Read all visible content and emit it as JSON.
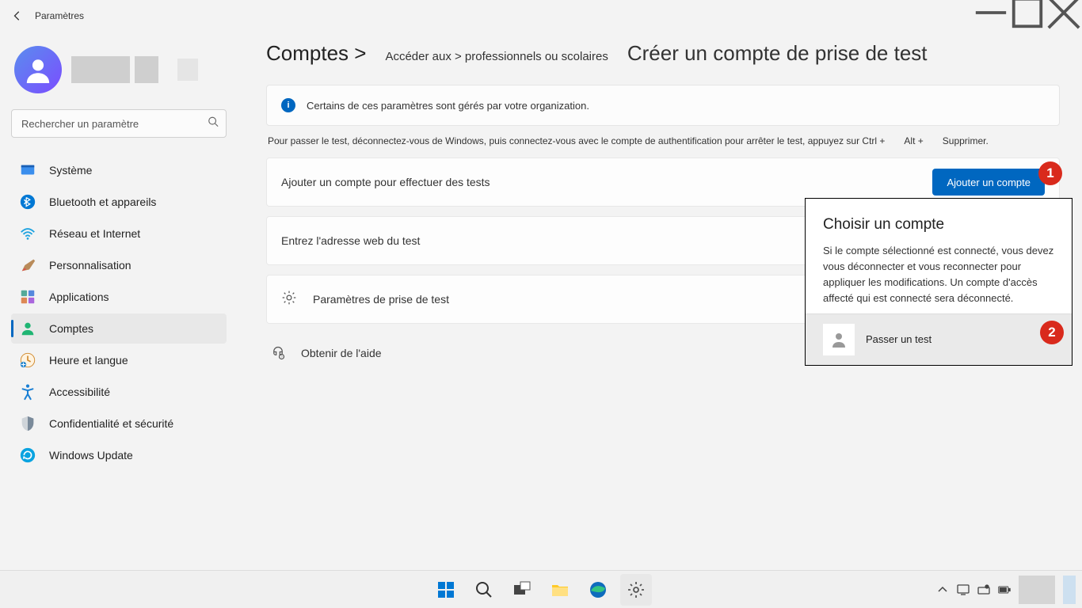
{
  "app_title": "Paramètres",
  "search": {
    "placeholder": "Rechercher un paramètre"
  },
  "nav": {
    "system": "Système",
    "bluetooth": "Bluetooth et appareils",
    "network": "Réseau et Internet",
    "personalization": "Personnalisation",
    "apps": "Applications",
    "accounts": "Comptes",
    "time": "Heure et langue",
    "accessibility": "Accessibilité",
    "privacy": "Confidentialité et sécurité",
    "update": "Windows Update"
  },
  "breadcrumbs": {
    "p1": "Comptes >",
    "p2": "Accéder aux > professionnels ou scolaires",
    "p3": "Créer un compte de prise de test"
  },
  "banner": "Certains de ces paramètres sont gérés par votre organization.",
  "instruction": {
    "main": "Pour passer le test, déconnectez-vous de Windows, puis connectez-vous avec le compte de authentification pour arrêter le test, appuyez sur Ctrl +",
    "alt": "Alt +",
    "del": "Supprimer."
  },
  "cards": {
    "add_account_label": "Ajouter un compte pour effectuer des tests",
    "add_account_button": "Ajouter un compte",
    "url_label": "Entrez l'adresse web du test",
    "settings_label": "Paramètres de prise de test"
  },
  "help": "Obtenir de l'aide",
  "popup": {
    "title": "Choisir un compte",
    "desc": "Si le compte sélectionné est connecté, vous devez vous déconnecter et vous reconnecter pour appliquer les modifications. Un compte d'accès affecté qui est connecté sera déconnecté.",
    "item": "Passer un test"
  },
  "callouts": {
    "one": "1",
    "two": "2"
  }
}
